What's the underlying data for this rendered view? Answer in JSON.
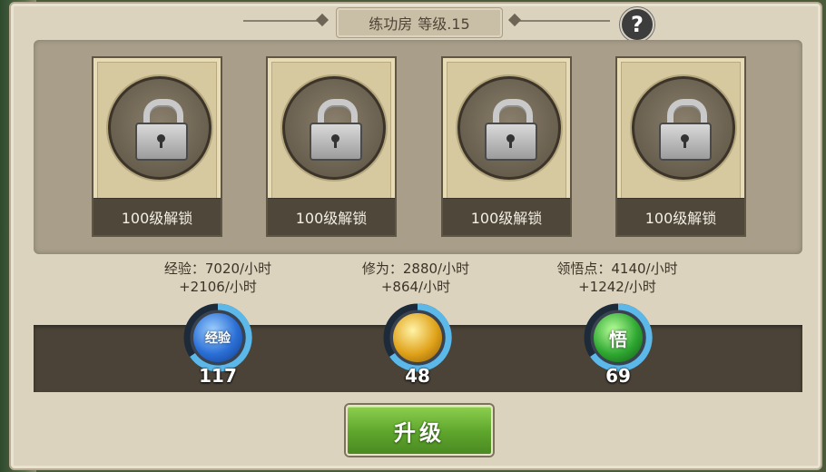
{
  "header": {
    "title": "练功房",
    "level": "等级.15",
    "help_label": "?"
  },
  "slots": [
    {
      "label": "100级解锁",
      "locked": true
    },
    {
      "label": "100级解锁",
      "locked": true
    },
    {
      "label": "100级解锁",
      "locked": true
    },
    {
      "label": "100级解锁",
      "locked": true
    }
  ],
  "stats": [
    {
      "line1": "经验：7020/小时",
      "line2": "+2106/小时",
      "value": "117",
      "orb_text": "经验",
      "color": "#2a6fd6"
    },
    {
      "line1": "修为：2880/小时",
      "line2": "+864/小时",
      "value": "48",
      "orb_text": "",
      "color": "#e0a21a"
    },
    {
      "line1": "领悟点：4140/小时",
      "line2": "+1242/小时",
      "value": "69",
      "orb_text": "悟",
      "color": "#2fa832"
    }
  ],
  "upgrade_button": {
    "label": "升级"
  },
  "colors": {
    "panel": "#dcd3bf",
    "ring": "#5bb8e8",
    "button": "#5ea52c"
  }
}
